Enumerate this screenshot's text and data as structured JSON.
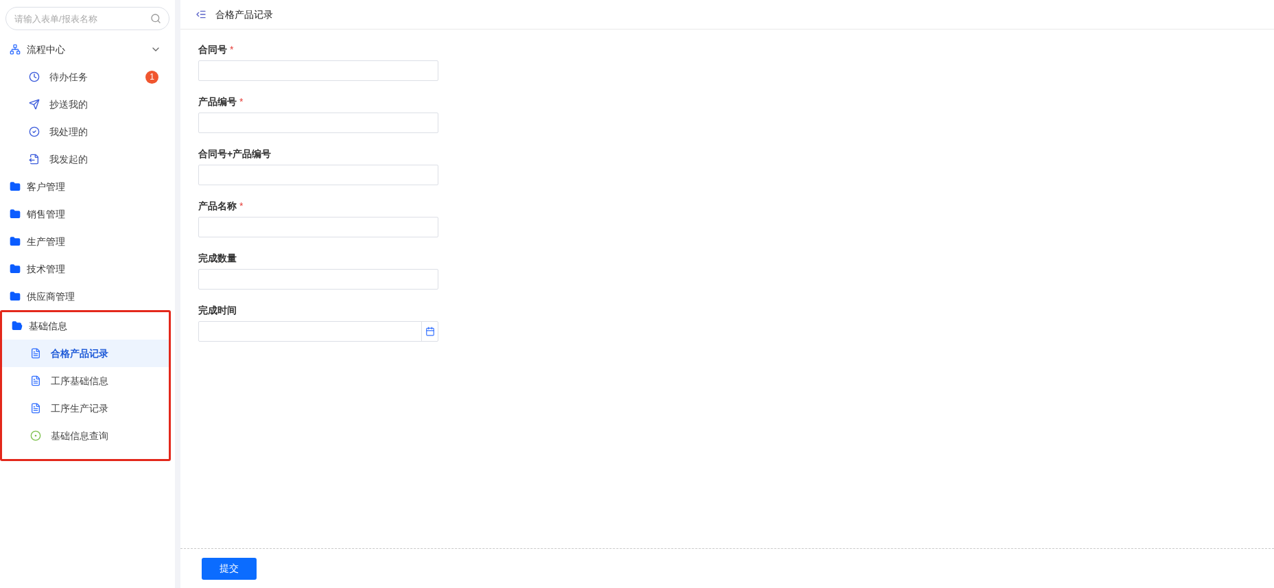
{
  "sidebar": {
    "search": {
      "placeholder": "请输入表单/报表名称"
    },
    "items": [
      {
        "kind": "flow",
        "label": "流程中心",
        "expanded": true,
        "highlighted": false,
        "children": [
          {
            "label": "待办任务",
            "badge": "1",
            "selected": false
          },
          {
            "label": "抄送我的",
            "selected": false
          },
          {
            "label": "我处理的",
            "selected": false
          },
          {
            "label": "我发起的",
            "selected": false
          }
        ]
      },
      {
        "kind": "folder",
        "label": "客户管理",
        "expanded": false,
        "highlighted": false
      },
      {
        "kind": "folder",
        "label": "销售管理",
        "expanded": false,
        "highlighted": false
      },
      {
        "kind": "folder",
        "label": "生产管理",
        "expanded": false,
        "highlighted": false
      },
      {
        "kind": "folder",
        "label": "技术管理",
        "expanded": false,
        "highlighted": false
      },
      {
        "kind": "folder",
        "label": "供应商管理",
        "expanded": false,
        "highlighted": false
      },
      {
        "kind": "folder",
        "label": "基础信息",
        "expanded": true,
        "highlighted": true,
        "children": [
          {
            "kind": "form",
            "label": "合格产品记录",
            "selected": true
          },
          {
            "kind": "form",
            "label": "工序基础信息",
            "selected": false
          },
          {
            "kind": "form",
            "label": "工序生产记录",
            "selected": false
          },
          {
            "kind": "query",
            "label": "基础信息查询",
            "selected": false
          }
        ]
      }
    ]
  },
  "header": {
    "title": "合格产品记录"
  },
  "form": {
    "fields": [
      {
        "kind": "text",
        "label": "合同号",
        "required_mark": "*"
      },
      {
        "kind": "text",
        "label": "产品编号",
        "required_mark": "*"
      },
      {
        "kind": "text",
        "label": "合同号+产品编号"
      },
      {
        "kind": "text",
        "label": "产品名称",
        "required_mark": "*"
      },
      {
        "kind": "text",
        "label": "完成数量"
      },
      {
        "kind": "date",
        "label": "完成时间"
      }
    ]
  },
  "footer": {
    "submit": "提交"
  }
}
